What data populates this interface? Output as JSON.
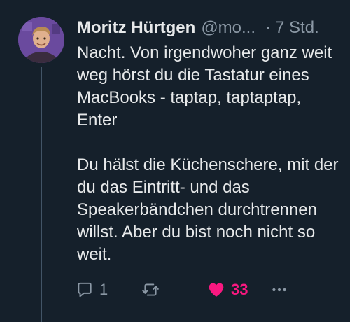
{
  "tweet": {
    "author_name": "Moritz Hürtgen",
    "handle": "@mo...",
    "separator": "·",
    "time": "7 Std.",
    "paragraph_1": "Nacht. Von irgendwoher ganz weit weg hörst du die Tastatur eines MacBooks - taptap, taptaptap, Enter",
    "paragraph_2": "Du hälst die Küchenschere, mit der du das Eintritt- und das Speakerbändchen durchtrennen willst. Aber du bist noch nicht so weit."
  },
  "actions": {
    "reply_count": "1",
    "like_count": "33"
  },
  "icons": {
    "reply": "reply-icon",
    "retweet": "retweet-icon",
    "like": "heart-icon",
    "more": "more-icon"
  },
  "colors": {
    "background": "#15202b",
    "text": "#e7e9ea",
    "secondary": "#8b98a5",
    "like": "#f91880",
    "thread_line": "#425466"
  }
}
